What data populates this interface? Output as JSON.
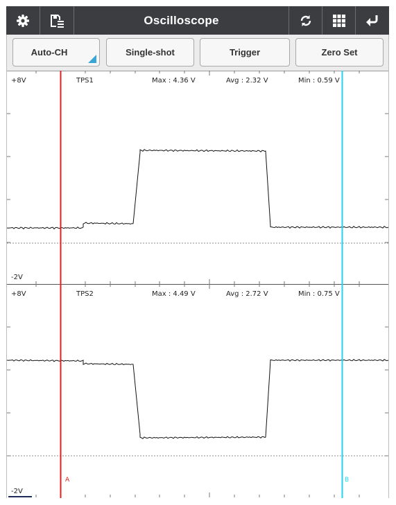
{
  "app": {
    "title": "Oscilloscope",
    "toolbar_icons": [
      "settings-icon",
      "save-icon",
      "refresh-icon",
      "grid-icon",
      "back-icon"
    ]
  },
  "buttons": {
    "auto_ch": "Auto-CH",
    "single_shot": "Single-shot",
    "trigger": "Trigger",
    "zero_set": "Zero Set"
  },
  "channels": [
    {
      "name": "TPS1",
      "top_label": "+8V",
      "bottom_label": "-2V",
      "max": "Max : 4.36 V",
      "avg": "Avg : 2.32 V",
      "min": "Min : 0.59 V"
    },
    {
      "name": "TPS2",
      "top_label": "+8V",
      "bottom_label": "-2V",
      "max": "Max : 4.49 V",
      "avg": "Avg : 2.72 V",
      "min": "Min : 0.75 V"
    }
  ],
  "cursors": {
    "a_label": "A",
    "b_label": "B",
    "a_color": "#e0201c",
    "b_color": "#1fd6f0"
  },
  "colors": {
    "toolbar_bg": "#3c3d41",
    "button_accent": "#3aa6d8",
    "trace": "#111111"
  }
}
